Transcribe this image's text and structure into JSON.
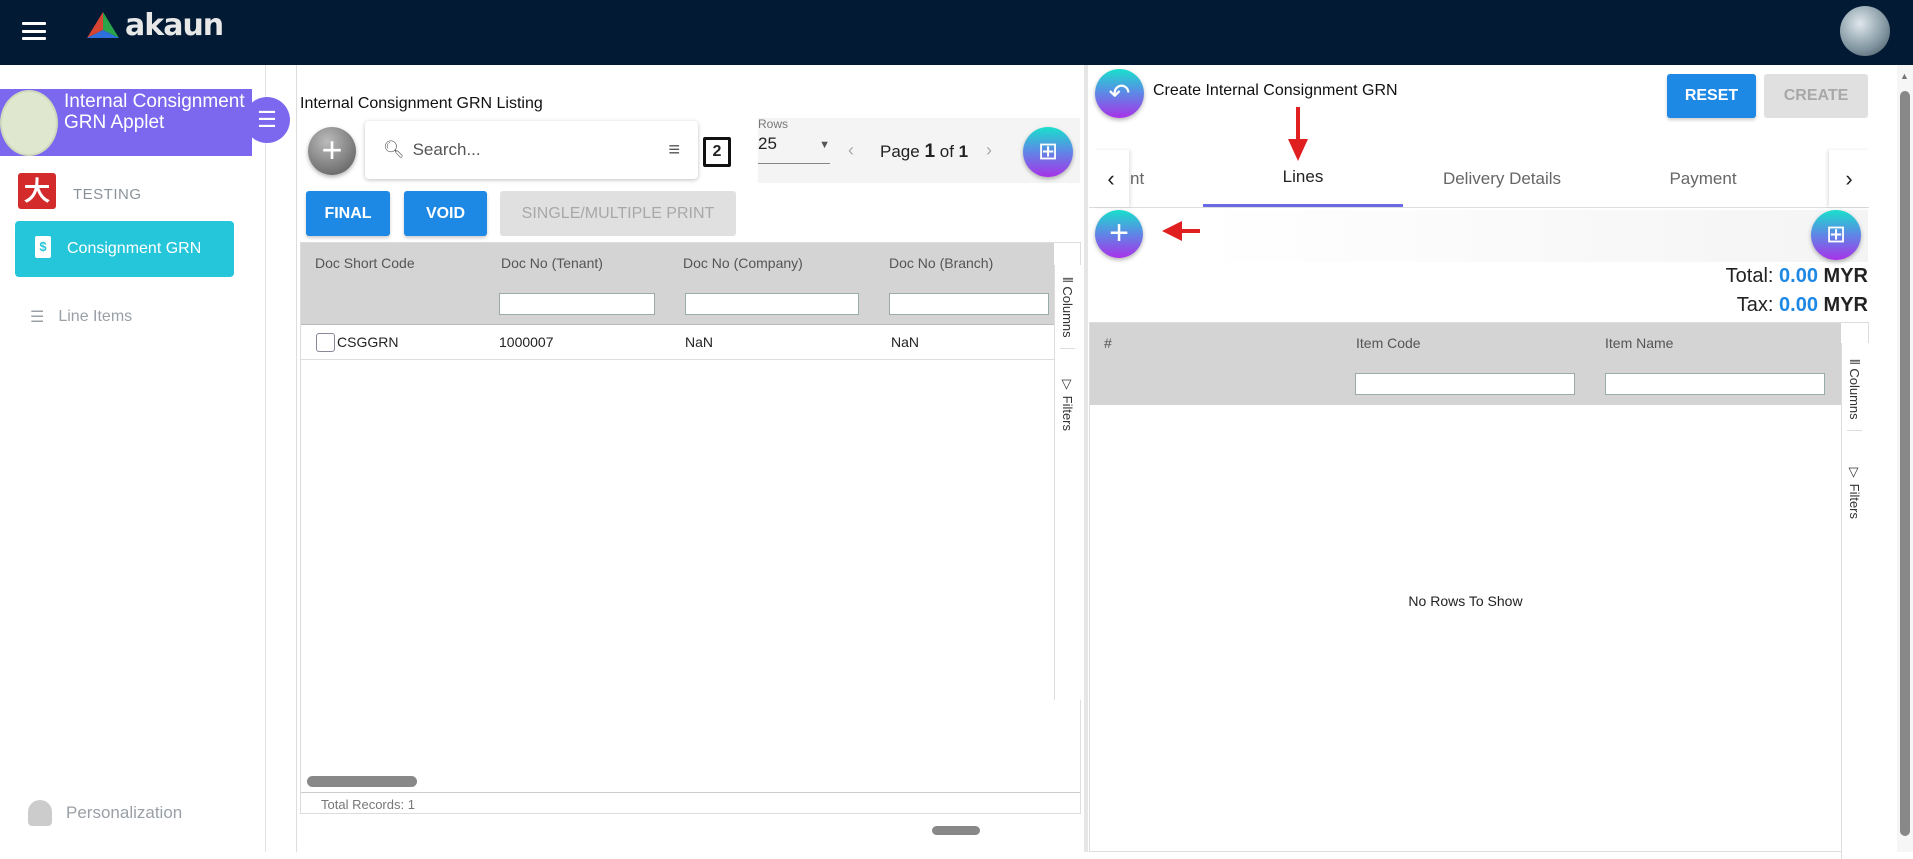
{
  "header": {
    "logo_text": "akaun"
  },
  "sidebar": {
    "applet_title": "Internal Consignment GRN Applet",
    "org": "TESTING",
    "active_item": "Consignment GRN",
    "items": [
      {
        "label": "Line Items"
      }
    ],
    "footer": "Personalization"
  },
  "listing": {
    "title": "Internal Consignment GRN Listing",
    "search_placeholder": "Search...",
    "rows_label": "Rows",
    "rows_value": "25",
    "page_prefix": "Page",
    "page_current": "1",
    "page_of": "of",
    "page_total": "1",
    "buttons": {
      "final": "FINAL",
      "void": "VOID",
      "print": "SINGLE/MULTIPLE PRINT"
    },
    "columns": [
      "Doc Short Code",
      "Doc No (Tenant)",
      "Doc No (Company)",
      "Doc No (Branch)"
    ],
    "rows": [
      [
        "CSGGRN",
        "1000007",
        "NaN",
        "NaN"
      ]
    ],
    "side_tools": {
      "columns": "Columns",
      "filters": "Filters"
    },
    "footer": "Total Records: 1"
  },
  "form": {
    "title": "Create Internal Consignment GRN",
    "reset": "RESET",
    "create": "CREATE",
    "tabs": [
      {
        "label": "nt"
      },
      {
        "label": "Lines",
        "active": true
      },
      {
        "label": "Delivery Details"
      },
      {
        "label": "Payment"
      }
    ],
    "total_label": "Total:",
    "total_value": "0.00",
    "tax_label": "Tax:",
    "tax_value": "0.00",
    "currency": "MYR",
    "columns": [
      "#",
      "Item Code",
      "Item Name"
    ],
    "empty_text": "No Rows To Show",
    "side_tools": {
      "columns": "Columns",
      "filters": "Filters"
    }
  },
  "colors": {
    "header": "#021a33",
    "applet": "#7b68ee",
    "active": "#26c6da",
    "primary": "#1e88e5",
    "annotation": "#e02020"
  }
}
